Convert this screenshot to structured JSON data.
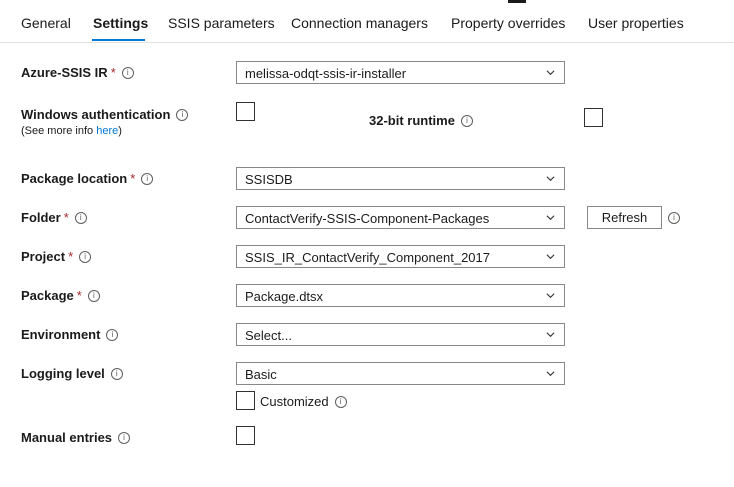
{
  "tabs": [
    "General",
    "Settings",
    "SSIS parameters",
    "Connection managers",
    "Property overrides",
    "User properties"
  ],
  "active_tab": "Settings",
  "required_marker": "*",
  "info_glyph": "i",
  "fields": {
    "azure_ssis_ir": {
      "label": "Azure-SSIS IR",
      "value": "melissa-odqt-ssis-ir-installer"
    },
    "windows_auth": {
      "label": "Windows authentication",
      "sub_prefix": "(See more info ",
      "sub_link": "here",
      "sub_suffix": ")",
      "checked": false
    },
    "runtime_32bit": {
      "label": "32-bit runtime",
      "checked": false
    },
    "package_location": {
      "label": "Package location",
      "value": "SSISDB"
    },
    "folder": {
      "label": "Folder",
      "value": "ContactVerify-SSIS-Component-Packages",
      "refresh_label": "Refresh"
    },
    "project": {
      "label": "Project",
      "value": "SSIS_IR_ContactVerify_Component_2017"
    },
    "package": {
      "label": "Package",
      "value": "Package.dtsx"
    },
    "environment": {
      "label": "Environment",
      "value": "Select..."
    },
    "logging_level": {
      "label": "Logging level",
      "value": "Basic",
      "customized_label": "Customized",
      "customized_checked": false
    },
    "manual_entries": {
      "label": "Manual entries",
      "checked": false
    }
  },
  "colors": {
    "accent": "#0078d4",
    "required": "#a4262c",
    "border": "#8a8886"
  }
}
